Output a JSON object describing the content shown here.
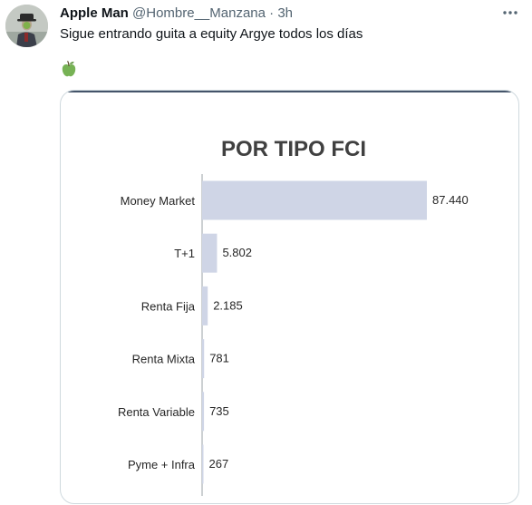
{
  "tweet": {
    "author_name": "Apple Man",
    "author_handle": "@Hombre__Manzana",
    "separator": "·",
    "time": "3h",
    "text": "Sigue entrando guita a equity Argye todos los días",
    "emoji": "green-apple-icon",
    "more_icon": "more-horizontal-icon"
  },
  "colors": {
    "bar": "#cfd5e6",
    "accent_line": "#44546a",
    "axis": "#9aa0a6",
    "chart_text": "#262626"
  },
  "chart_data": {
    "type": "bar",
    "orientation": "horizontal",
    "title": "POR TIPO FCI",
    "categories": [
      "Money Market",
      "T+1",
      "Renta Fija",
      "Renta Mixta",
      "Renta Variable",
      "Pyme + Infra"
    ],
    "values": [
      87440,
      5802,
      2185,
      781,
      735,
      267
    ],
    "value_labels": [
      "87.440",
      "5.802",
      "2.185",
      "781",
      "735",
      "267"
    ],
    "xlim": [
      0,
      87440
    ],
    "grid": false,
    "legend": "none"
  }
}
